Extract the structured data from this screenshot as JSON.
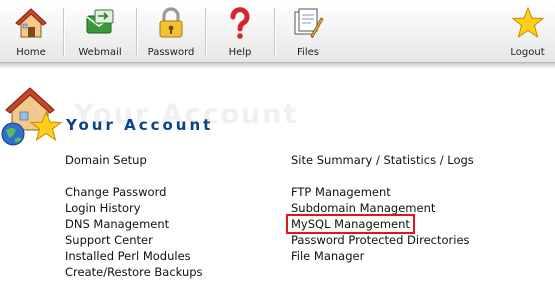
{
  "toolbar": {
    "items": [
      {
        "label": "Home",
        "icon": "home-icon"
      },
      {
        "label": "Webmail",
        "icon": "webmail-icon"
      },
      {
        "label": "Password",
        "icon": "lock-icon"
      },
      {
        "label": "Help",
        "icon": "question-icon"
      },
      {
        "label": "Files",
        "icon": "files-icon"
      },
      {
        "label": "Logout",
        "icon": "star-icon"
      }
    ]
  },
  "account": {
    "title": "Your Account",
    "watermark": "Your Account",
    "icon": "house-star-globe-icon"
  },
  "links": {
    "left": [
      "Domain Setup",
      "Change Password",
      "Login History",
      "DNS Management",
      "Support Center",
      "Installed Perl Modules",
      "Create/Restore Backups"
    ],
    "right": [
      "Site Summary / Statistics / Logs",
      "FTP Management",
      "Subdomain Management",
      "MySQL Management",
      "Password Protected Directories",
      "File Manager"
    ]
  },
  "highlight": {
    "item": "MySQL Management",
    "color": "#e4141b"
  },
  "colors": {
    "title": "#0b3f8f",
    "toolbar_bg": "#eeeeee"
  }
}
